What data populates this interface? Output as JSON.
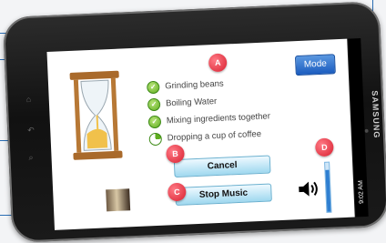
{
  "device": {
    "brand": "SAMSUNG"
  },
  "status": {
    "time": "9:02 AM"
  },
  "app": {
    "mode_label": "Mode",
    "steps": [
      {
        "label": "Grinding beans",
        "state": "done"
      },
      {
        "label": "Boiling Water",
        "state": "done"
      },
      {
        "label": "Mixing ingredients together",
        "state": "done"
      },
      {
        "label": "Dropping a cup of coffee",
        "state": "pending"
      }
    ],
    "cancel_label": "Cancel",
    "stop_music_label": "Stop Music",
    "volume_level": 0.85
  },
  "annotations": {
    "a": "A",
    "b": "B",
    "c": "C",
    "d": "D"
  },
  "colors": {
    "badge": "#d81f2f",
    "accent": "#1b5cbf",
    "button_fill": "#9fd8ef",
    "check": "#5fae1f"
  }
}
